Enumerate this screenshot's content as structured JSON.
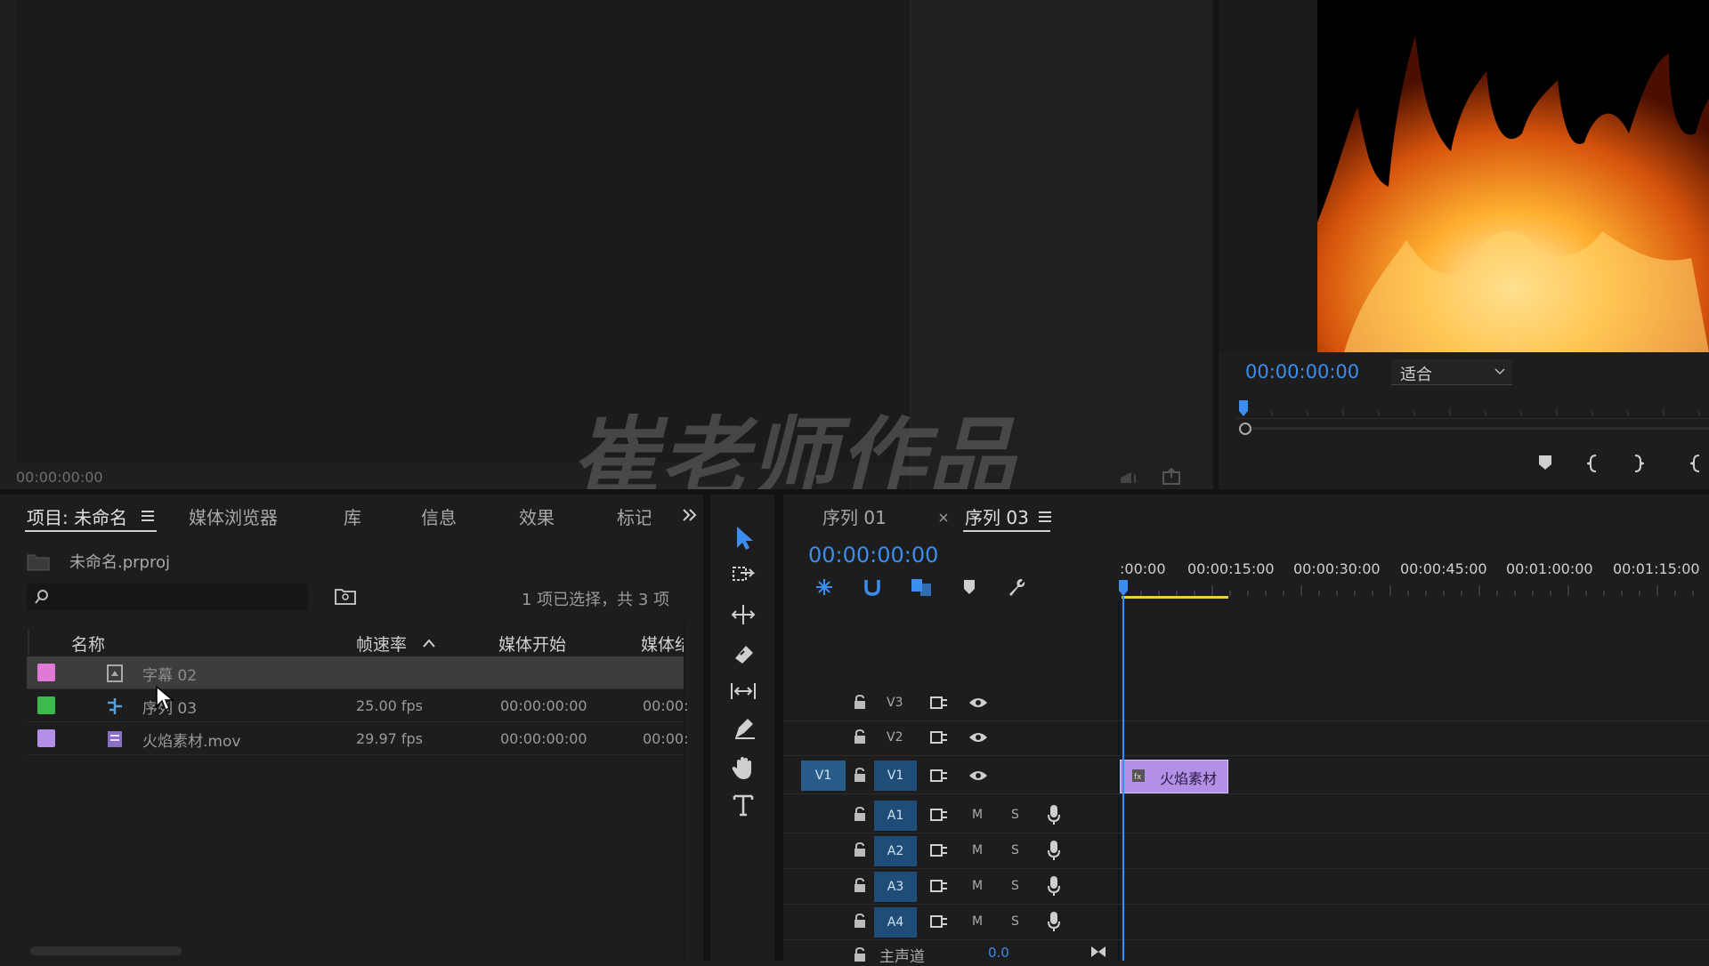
{
  "source_monitor": {
    "timecode": "00:00:00:00"
  },
  "program_monitor": {
    "timecode": "00:00:00:00",
    "zoom": "适合"
  },
  "watermark": "崔老师作品",
  "project_panel": {
    "tabs": [
      "项目: 未命名",
      "媒体浏览器",
      "库",
      "信息",
      "效果",
      "标记"
    ],
    "file": "未命名.prproj",
    "search_placeholder": "",
    "selection_status": "1 项已选择，共 3 项",
    "columns": [
      "名称",
      "帧速率",
      "媒体开始",
      "媒体结"
    ],
    "items": [
      {
        "name": "字幕 02",
        "fps": "",
        "start": "",
        "end": "",
        "color": "#e07ad8"
      },
      {
        "name": "序列 03",
        "fps": "25.00 fps",
        "start": "00:00:00:00",
        "end": "00:00:",
        "color": "#3dba4e"
      },
      {
        "name": "火焰素材.mov",
        "fps": "29.97 fps",
        "start": "00:00:00:00",
        "end": "00:00:",
        "color": "#b38fe8"
      }
    ]
  },
  "timeline": {
    "tabs": [
      "序列 01",
      "序列 03"
    ],
    "timecode": "00:00:00:00",
    "ruler": [
      ":00:00",
      "00:00:15:00",
      "00:00:30:00",
      "00:00:45:00",
      "00:01:00:00",
      "00:01:15:00"
    ],
    "video_tracks": [
      "V3",
      "V2",
      "V1"
    ],
    "audio_tracks": [
      "A1",
      "A2",
      "A3",
      "A4"
    ],
    "source_patch": "V1",
    "mute_label": "M",
    "solo_label": "S",
    "master": {
      "label": "主声道",
      "value": "0.0"
    },
    "clip": {
      "name": "火焰素材",
      "color": "#b38fe8"
    }
  }
}
